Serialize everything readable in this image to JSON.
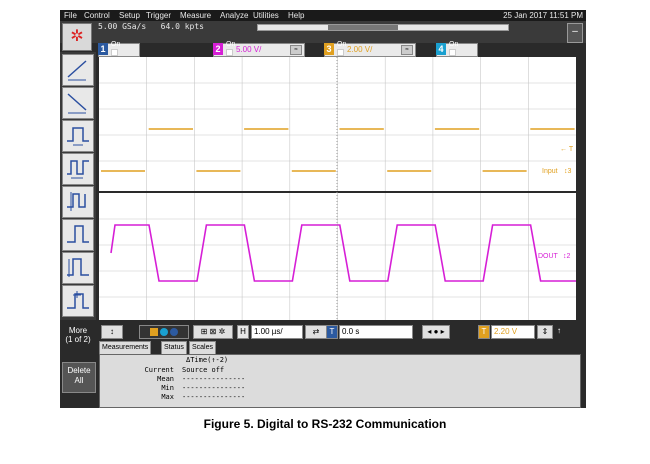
{
  "menu": [
    "File",
    "Control",
    "Setup",
    "Trigger",
    "Measure",
    "Analyze",
    "Utilities",
    "Help"
  ],
  "clock": "25 Jan 2017 11:51 PM",
  "acquisition": {
    "rate": "5.00 GSa/s",
    "points": "64.0 kpts"
  },
  "channels": [
    {
      "num": "1",
      "on": "On",
      "scale": "",
      "color": "#2c5aa0"
    },
    {
      "num": "2",
      "on": "On",
      "scale": "5.00 V/",
      "color": "#d61fd6"
    },
    {
      "num": "3",
      "on": "On",
      "scale": "2.00 V/",
      "color": "#e0a020"
    },
    {
      "num": "4",
      "on": "On",
      "scale": "",
      "color": "#1aa0d0"
    }
  ],
  "left_buttons": [
    "rise-time-icon",
    "fall-time-icon",
    "pulse-width-icon",
    "period-icon",
    "edge-icon",
    "pulse-icon",
    "overshoot-icon",
    "custom-icon"
  ],
  "more": {
    "line1": "More",
    "line2": "(1 of 2)"
  },
  "delete_all": {
    "line1": "Delete",
    "line2": "All"
  },
  "waves": [
    {
      "label": "Input",
      "marker": "↕3",
      "color": "#e0a020"
    },
    {
      "label": "DOUT",
      "marker": "↕2",
      "color": "#d61fd6"
    }
  ],
  "trigger_marker": "← T",
  "bottom": {
    "horiz_btn": "H",
    "timebase": "1.00 µs/",
    "trig_btn": "T",
    "delay": "0.0 s",
    "trig_ch": "T",
    "trig_level": "2.20 V",
    "arrow": "↑"
  },
  "tabs": [
    "Measurements",
    "Status",
    "Scales"
  ],
  "measurements": {
    "header": "ΔTime(↑-2)",
    "current_label": "Current",
    "current_value": "Source off",
    "mean_label": "Mean",
    "min_label": "Min",
    "max_label": "Max",
    "dashes": "---------------"
  },
  "caption": "Figure 5. Digital to RS-232 Communication"
}
